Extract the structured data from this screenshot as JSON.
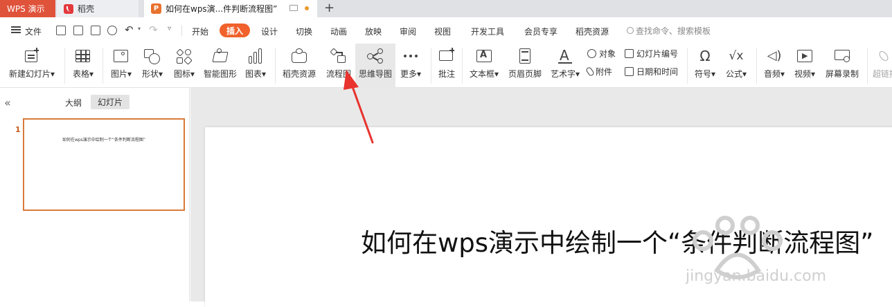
{
  "tabs": {
    "app": "WPS 演示",
    "daoke": "稻壳",
    "document": "如何在wps演...件判断流程图”"
  },
  "menu": {
    "file": "文件",
    "items": [
      "开始",
      "插入",
      "设计",
      "切换",
      "动画",
      "放映",
      "审阅",
      "视图",
      "开发工具",
      "会员专享",
      "稻壳资源"
    ],
    "active": "插入",
    "search_placeholder": "查找命令、搜索模板"
  },
  "ribbon": {
    "new_slide": "新建幻灯片",
    "table": "表格",
    "picture": "图片",
    "shape": "形状",
    "icon": "图标",
    "smart_graphic": "智能图形",
    "chart": "图表",
    "daoke_resource": "稻壳资源",
    "flowchart": "流程图",
    "mindmap": "思维导图",
    "more": "更多",
    "comment": "批注",
    "textbox": "文本框",
    "header_footer": "页眉页脚",
    "wordart": "艺术字",
    "object": "对象",
    "attachment": "附件",
    "slide_number": "幻灯片编号",
    "date_time": "日期和时间",
    "symbol": "符号",
    "formula": "公式",
    "audio": "音频",
    "video": "视频",
    "screen_record": "屏幕录制",
    "hyperlink": "超链接"
  },
  "panel": {
    "outline_tab": "大纲",
    "slides_tab": "幻灯片",
    "slide_number": "1",
    "thumb_title": "如何在wps演示中绘制一个“条件判断流程图”"
  },
  "slide": {
    "title": "如何在wps演示中绘制一个“条件判断流程图”"
  },
  "colors": {
    "accent": "#f0612b",
    "wps_tab": "#e0533b",
    "thumb_border": "#d97a3a",
    "arrow": "#e8332e"
  }
}
